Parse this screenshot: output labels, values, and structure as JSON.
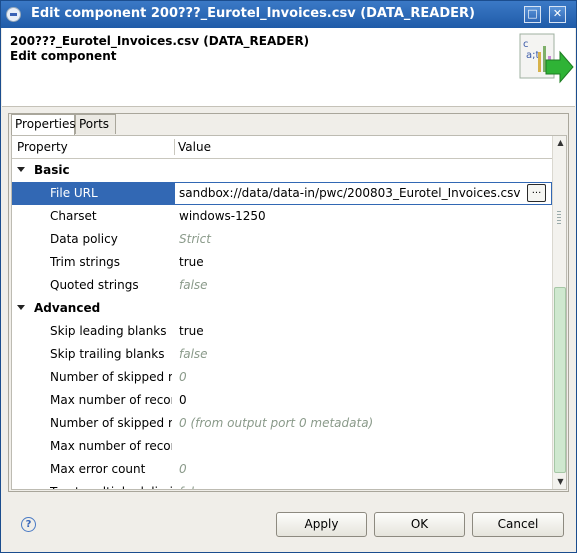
{
  "window": {
    "title": "Edit component 200???_Eurotel_Invoices.csv (DATA_READER)",
    "maximize_glyph": "□",
    "close_glyph": "✕"
  },
  "header": {
    "title": "200???_Eurotel_Invoices.csv (DATA_READER)",
    "subtitle": "Edit component",
    "image_icon": "csv-reader-wizard-icon"
  },
  "tabs": [
    {
      "label": "Properties",
      "active": true
    },
    {
      "label": "Ports",
      "active": false
    }
  ],
  "table": {
    "columns": [
      "Property",
      "Value"
    ],
    "rows": [
      {
        "kind": "category",
        "label": "Basic"
      },
      {
        "kind": "prop",
        "name": "File URL",
        "value": "sandbox://data/data-in/pwc/200803_Eurotel_Invoices.csv",
        "default": false,
        "selected": true
      },
      {
        "kind": "prop",
        "name": "Charset",
        "value": "windows-1250",
        "default": false
      },
      {
        "kind": "prop",
        "name": "Data policy",
        "value": "Strict",
        "default": true
      },
      {
        "kind": "prop",
        "name": "Trim strings",
        "value": "true",
        "default": false
      },
      {
        "kind": "prop",
        "name": "Quoted strings",
        "value": "false",
        "default": true
      },
      {
        "kind": "category",
        "label": "Advanced"
      },
      {
        "kind": "prop",
        "name": "Skip leading blanks",
        "value": "true",
        "default": false
      },
      {
        "kind": "prop",
        "name": "Skip trailing blanks",
        "value": "false",
        "default": true
      },
      {
        "kind": "prop",
        "name": "Number of skipped re",
        "value": "0",
        "default": true
      },
      {
        "kind": "prop",
        "name": "Max number of record",
        "value": "0",
        "default": false
      },
      {
        "kind": "prop",
        "name": "Number of skipped re",
        "value": "0 (from output port 0 metadata)",
        "default": true
      },
      {
        "kind": "prop",
        "name": "Max number of record",
        "value": "",
        "default": false
      },
      {
        "kind": "prop",
        "name": "Max error count",
        "value": "0",
        "default": true
      },
      {
        "kind": "prop",
        "name": "Treat multiple delimi",
        "value": "false",
        "default": true
      }
    ],
    "edit_button_label": "..."
  },
  "buttons": {
    "help": "?",
    "apply": "Apply",
    "ok": "OK",
    "cancel": "Cancel"
  }
}
